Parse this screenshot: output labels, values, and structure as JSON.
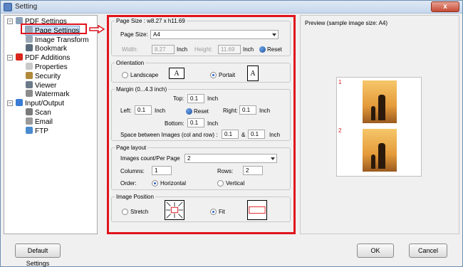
{
  "window": {
    "title": "Setting",
    "close_label": "x"
  },
  "tree": {
    "items": [
      {
        "label": "PDF Settings"
      },
      {
        "label": "Page Settings"
      },
      {
        "label": "Image Transform"
      },
      {
        "label": "Bookmark"
      },
      {
        "label": "PDF Additions"
      },
      {
        "label": "Properties"
      },
      {
        "label": "Security"
      },
      {
        "label": "Viewer"
      },
      {
        "label": "Watermark"
      },
      {
        "label": "Input/Output"
      },
      {
        "label": "Scan"
      },
      {
        "label": "Email"
      },
      {
        "label": "FTP"
      }
    ]
  },
  "page_size": {
    "group_title": "Page Size : w8.27 x h11.69",
    "size_label": "Page Size:",
    "size_value": "A4",
    "width_label": "Width:",
    "width_value": "8.27",
    "width_unit": "Inch",
    "height_label": "Height:",
    "height_value": "11.69",
    "height_unit": "Inch",
    "reset_label": "Reset"
  },
  "orientation": {
    "group_title": "Orientation",
    "landscape_label": "Landscape",
    "portrait_label": "Portait",
    "landscape_glyph": "A",
    "portrait_glyph": "A"
  },
  "margin": {
    "group_title": "Margin (0...4.3 inch)",
    "top_label": "Top:",
    "top_value": "0.1",
    "top_unit": "Inch",
    "left_label": "Left:",
    "left_value": "0.1",
    "left_unit": "Inch",
    "reset_label": "Reset",
    "right_label": "Right:",
    "right_value": "0.1",
    "right_unit": "Inch",
    "bottom_label": "Bottom:",
    "bottom_value": "0.1",
    "bottom_unit": "Inch",
    "space_label": "Space between Images (col and row) :",
    "space_col": "0.1",
    "space_amp": "&",
    "space_row": "0.1",
    "space_unit": "Inch"
  },
  "page_layout": {
    "group_title": "Page layout",
    "count_label": "Images count/Per Page",
    "count_value": "2",
    "columns_label": "Columns:",
    "columns_value": "1",
    "rows_label": "Rows:",
    "rows_value": "2",
    "order_label": "Order:",
    "horizontal_label": "Horizontal",
    "vertical_label": "Vertical"
  },
  "image_position": {
    "group_title": "Image Position",
    "stretch_label": "Stretch",
    "fit_label": "Fit"
  },
  "preview": {
    "title": "Preview (sample image size: A4)",
    "page_num_1": "1",
    "page_num_2": "2"
  },
  "buttons": {
    "default": "Default Settings",
    "ok": "OK",
    "cancel": "Cancel"
  },
  "colors": {
    "highlight_red": "#e0141c",
    "accent_blue": "#2a65c7"
  }
}
